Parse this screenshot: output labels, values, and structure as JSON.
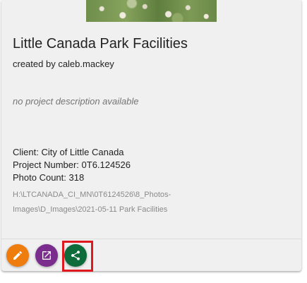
{
  "project": {
    "title": "Little Canada Park Facilities",
    "created_by": "created by caleb.mackey",
    "description": "no project description available",
    "client": "Client: City of Little Canada",
    "project_number": "Project Number: 0T6.124526",
    "photo_count": "Photo Count: 318",
    "path_line1": "H:\\LTCANADA_CI_MN\\0T6124526\\8_Photos-",
    "path_line2": "Images\\D_Images\\2021-05-11 Park Facilities"
  },
  "actions": [
    {
      "name": "edit",
      "icon": "pencil-icon",
      "color": "#ef7d0d"
    },
    {
      "name": "open",
      "icon": "open-in-new-icon",
      "color": "#7b2d8e"
    },
    {
      "name": "share",
      "icon": "share-icon",
      "color": "#0e6b3a",
      "highlighted": true
    }
  ],
  "highlight_color": "#e0191f"
}
